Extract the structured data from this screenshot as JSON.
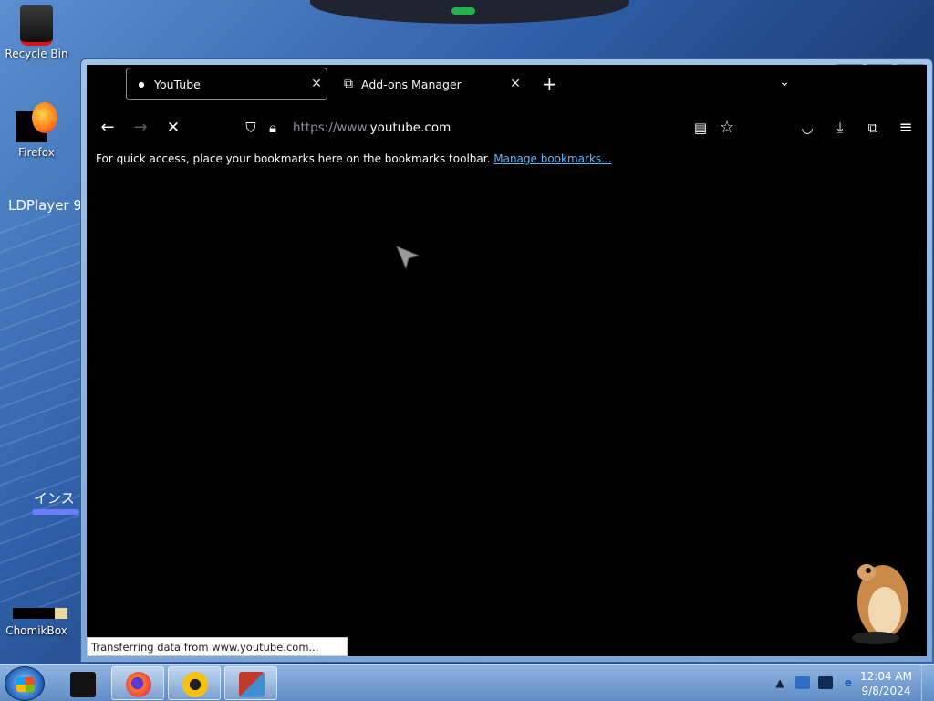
{
  "desktop": {
    "icons": [
      {
        "label": "Recycle Bin"
      },
      {
        "label": "Firefox"
      },
      {
        "label": "ChomikBox"
      }
    ],
    "ldplayer_text": "LDPlayer 9.",
    "install_text": "インス"
  },
  "browser": {
    "tabs": [
      {
        "title": "YouTube",
        "active": true
      },
      {
        "title": "Add-ons Manager",
        "active": false
      }
    ],
    "url": {
      "scheme_prefix": "https://www.",
      "host": "youtube.com"
    },
    "bookmarks_bar": {
      "message": "For quick access, place your bookmarks here on the bookmarks toolbar.",
      "link": "Manage bookmarks..."
    },
    "status_text": "Transferring data from www.youtube.com...",
    "window_controls": {
      "minimize": "▁",
      "maximize": "□",
      "close": "✕"
    }
  },
  "taskbar": {
    "clock_time": "12:04 AM",
    "clock_date": "9/8/2024",
    "apps": [
      "file-manager",
      "firefox",
      "ldplayer",
      "remote-desktop"
    ]
  }
}
